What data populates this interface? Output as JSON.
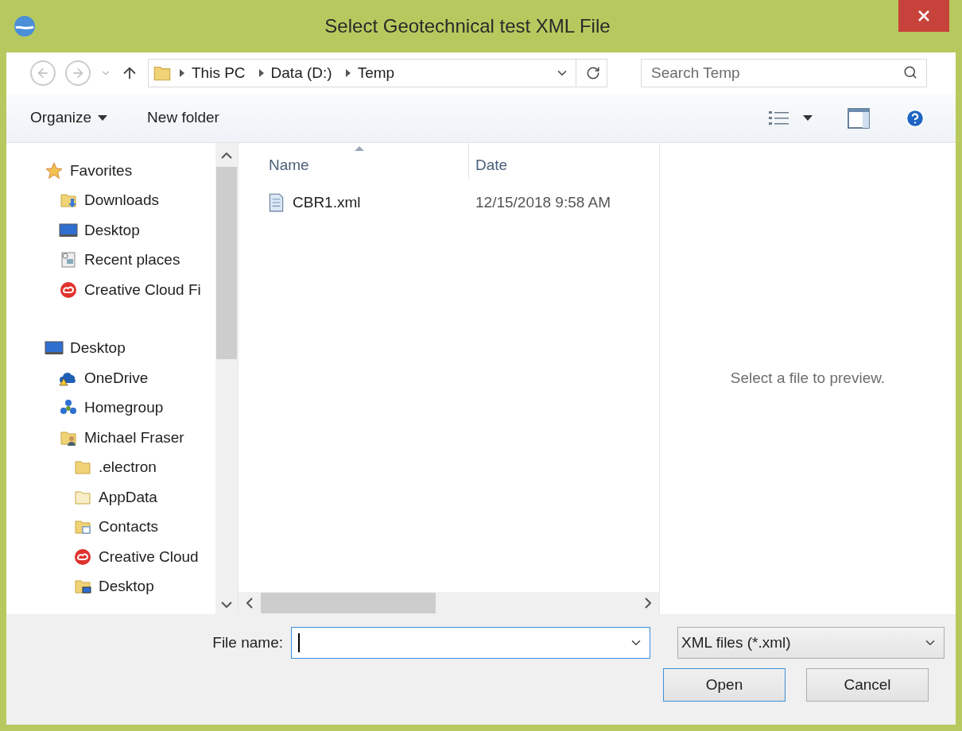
{
  "window": {
    "title": "Select Geotechnical test XML File"
  },
  "address": {
    "crumbs": [
      "This PC",
      "Data (D:)",
      "Temp"
    ]
  },
  "search": {
    "placeholder": "Search Temp"
  },
  "toolbar": {
    "organize": "Organize",
    "new_folder": "New folder"
  },
  "sidebar": {
    "groups": [
      {
        "label": "Favorites",
        "kind": "star",
        "children": [
          {
            "label": "Downloads",
            "kind": "downloads"
          },
          {
            "label": "Desktop",
            "kind": "monitor"
          },
          {
            "label": "Recent places",
            "kind": "recent"
          },
          {
            "label": "Creative Cloud Fi",
            "kind": "creative"
          }
        ]
      },
      {
        "label": "Desktop",
        "kind": "monitor",
        "children": [
          {
            "label": "OneDrive",
            "kind": "onedrive"
          },
          {
            "label": "Homegroup",
            "kind": "homegroup"
          },
          {
            "label": "Michael Fraser",
            "kind": "user",
            "children": [
              {
                "label": ".electron",
                "kind": "folder"
              },
              {
                "label": "AppData",
                "kind": "folder_pale"
              },
              {
                "label": "Contacts",
                "kind": "contacts"
              },
              {
                "label": "Creative Cloud",
                "kind": "creative"
              },
              {
                "label": "Desktop",
                "kind": "desktop_folder"
              }
            ]
          }
        ]
      }
    ]
  },
  "file_list": {
    "columns": [
      {
        "label": "Name",
        "sorted": true
      },
      {
        "label": "Date",
        "sorted": false
      }
    ],
    "rows": [
      {
        "name": "CBR1.xml",
        "date": "12/15/2018 9:58 AM"
      }
    ]
  },
  "preview": {
    "message": "Select a file to preview."
  },
  "footer": {
    "file_name_label": "File name:",
    "file_name_focused": true,
    "filter": "XML files (*.xml)",
    "buttons": [
      {
        "label": "Open",
        "default": true
      },
      {
        "label": "Cancel",
        "default": false
      }
    ]
  }
}
